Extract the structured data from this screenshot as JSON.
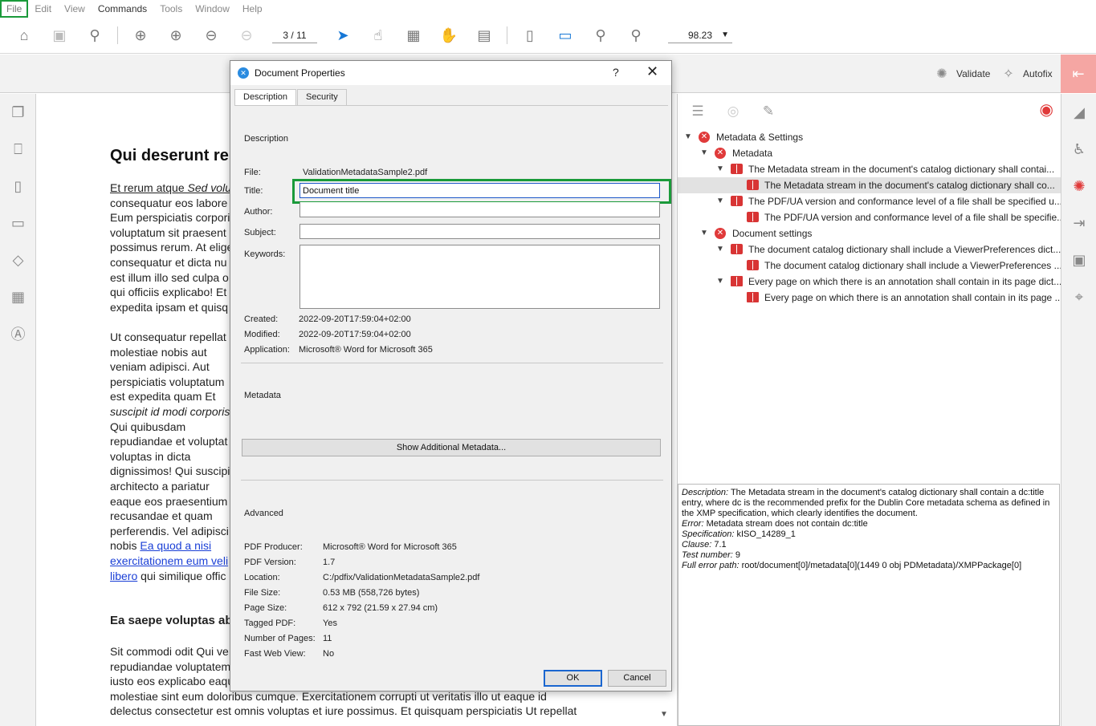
{
  "menu": [
    "File",
    "Edit",
    "View",
    "Commands",
    "Tools",
    "Window",
    "Help"
  ],
  "toolbar": {
    "page_field": "3 / 11",
    "zoom_value": "98.23"
  },
  "subbar": {
    "validate_label": "Validate",
    "autofix_label": "Autofix"
  },
  "document": {
    "heading": "Qui deserunt re",
    "para1": [
      [
        "Et rerum atque ",
        "Sed volu"
      ],
      "consequatur eos labore",
      "Eum perspiciatis corpori",
      "voluptatum sit praesent",
      "possimus rerum. At elige",
      "consequatur et dicta nu",
      "est illum illo sed culpa o",
      "qui officiis explicabo! Et",
      "expedita ipsam et quisq"
    ],
    "para2": [
      "Ut consequatur repellat",
      "molestiae nobis aut",
      "veniam adipisci. Aut",
      "perspiciatis voluptatum",
      "est expedita quam Et",
      "suscipit id modi corporis",
      "Qui quibusdam",
      "repudiandae et voluptat",
      "voluptas in dicta",
      "dignissimos! Qui suscipit",
      "architecto a pariatur",
      "eaque eos praesentium",
      "recusandae et quam",
      "perferendis. Vel adipisci",
      "nobis Ea quod a nisi",
      "exercitationem eum veli",
      "libero qui similique offic"
    ],
    "heading2": "Ea saepe voluptas ab",
    "para3": [
      "Sit commodi odit Qui ve",
      "repudiandae voluptatem",
      "iusto eos explicabo eaqu",
      "molestiae sint eum doloribus cumque. Exercitationem corrupti ut veritatis illo ut eaque id",
      "delectus consectetur est omnis voluptas et iure possimus. Et quisquam perspiciatis Ut repellat"
    ]
  },
  "tree": [
    {
      "label": "Metadata & Settings",
      "level": 0,
      "icon": "error"
    },
    {
      "label": "Metadata",
      "level": 1,
      "icon": "error"
    },
    {
      "label": "The Metadata stream in the document's catalog dictionary shall contai...",
      "level": 2,
      "icon": "book"
    },
    {
      "label": "The Metadata stream in the document's catalog dictionary shall co...",
      "level": 3,
      "icon": "book",
      "selected": true
    },
    {
      "label": "The PDF/UA version and conformance level of a file shall be specified u...",
      "level": 2,
      "icon": "book"
    },
    {
      "label": "The PDF/UA version and conformance level of a file shall be specifie...",
      "level": 3,
      "icon": "book"
    },
    {
      "label": "Document settings",
      "level": 1,
      "icon": "error"
    },
    {
      "label": "The document catalog dictionary shall include a ViewerPreferences dict...",
      "level": 2,
      "icon": "book"
    },
    {
      "label": "The document catalog dictionary shall include a ViewerPreferences ...",
      "level": 3,
      "icon": "book"
    },
    {
      "label": "Every page on which there is an annotation shall contain in its page dict...",
      "level": 2,
      "icon": "annot"
    },
    {
      "label": "Every page on which there is an annotation shall contain in its page ...",
      "level": 3,
      "icon": "annot"
    }
  ],
  "details": {
    "description_label": "Description:",
    "description_text": "The Metadata stream in the document's catalog dictionary shall contain a dc:title entry, where dc is the recommended prefix for the Dublin Core metadata schema as defined in the XMP specification, which clearly identifies the document.",
    "error_label": "Error:",
    "error_text": "Metadata stream does not contain dc:title",
    "spec_label": "Specification:",
    "spec_text": "kISO_14289_1",
    "clause_label": "Clause:",
    "clause_text": "7.1",
    "test_label": "Test number:",
    "test_text": "9",
    "path_label": "Full error path:",
    "path_text": "root/document[0]/metadata[0](1449 0 obj PDMetadata)/XMPPackage[0]"
  },
  "dialog": {
    "title": "Document Properties",
    "help": "?",
    "tabs": [
      "Description",
      "Security"
    ],
    "description_section": "Description",
    "file_label": "File:",
    "file_value": "ValidationMetadataSample2.pdf",
    "title_label": "Title:",
    "title_value": "Document title",
    "author_label": "Author:",
    "author_value": "",
    "subject_label": "Subject:",
    "subject_value": "",
    "keywords_label": "Keywords:",
    "keywords_value": "",
    "created_label": "Created:",
    "created_value": "2022-09-20T17:59:04+02:00",
    "modified_label": "Modified:",
    "modified_value": "2022-09-20T17:59:04+02:00",
    "application_label": "Application:",
    "application_value": "Microsoft® Word for Microsoft 365",
    "metadata_section": "Metadata",
    "show_metadata_label": "Show Additional Metadata...",
    "advanced_section": "Advanced",
    "producer_label": "PDF Producer:",
    "producer_value": "Microsoft® Word for Microsoft 365",
    "version_label": "PDF Version:",
    "version_value": "1.7",
    "location_label": "Location:",
    "location_value": "C:/pdfix/ValidationMetadataSample2.pdf",
    "filesize_label": "File Size:",
    "filesize_value": "0.53 MB (558,726 bytes)",
    "pagesize_label": "Page Size:",
    "pagesize_value": "612 x 792 (21.59 x 27.94 cm)",
    "tagged_label": "Tagged PDF:",
    "tagged_value": "Yes",
    "pages_label": "Number of Pages:",
    "pages_value": "11",
    "fastweb_label": "Fast Web View:",
    "fastweb_value": "No",
    "ok_label": "OK",
    "cancel_label": "Cancel"
  }
}
